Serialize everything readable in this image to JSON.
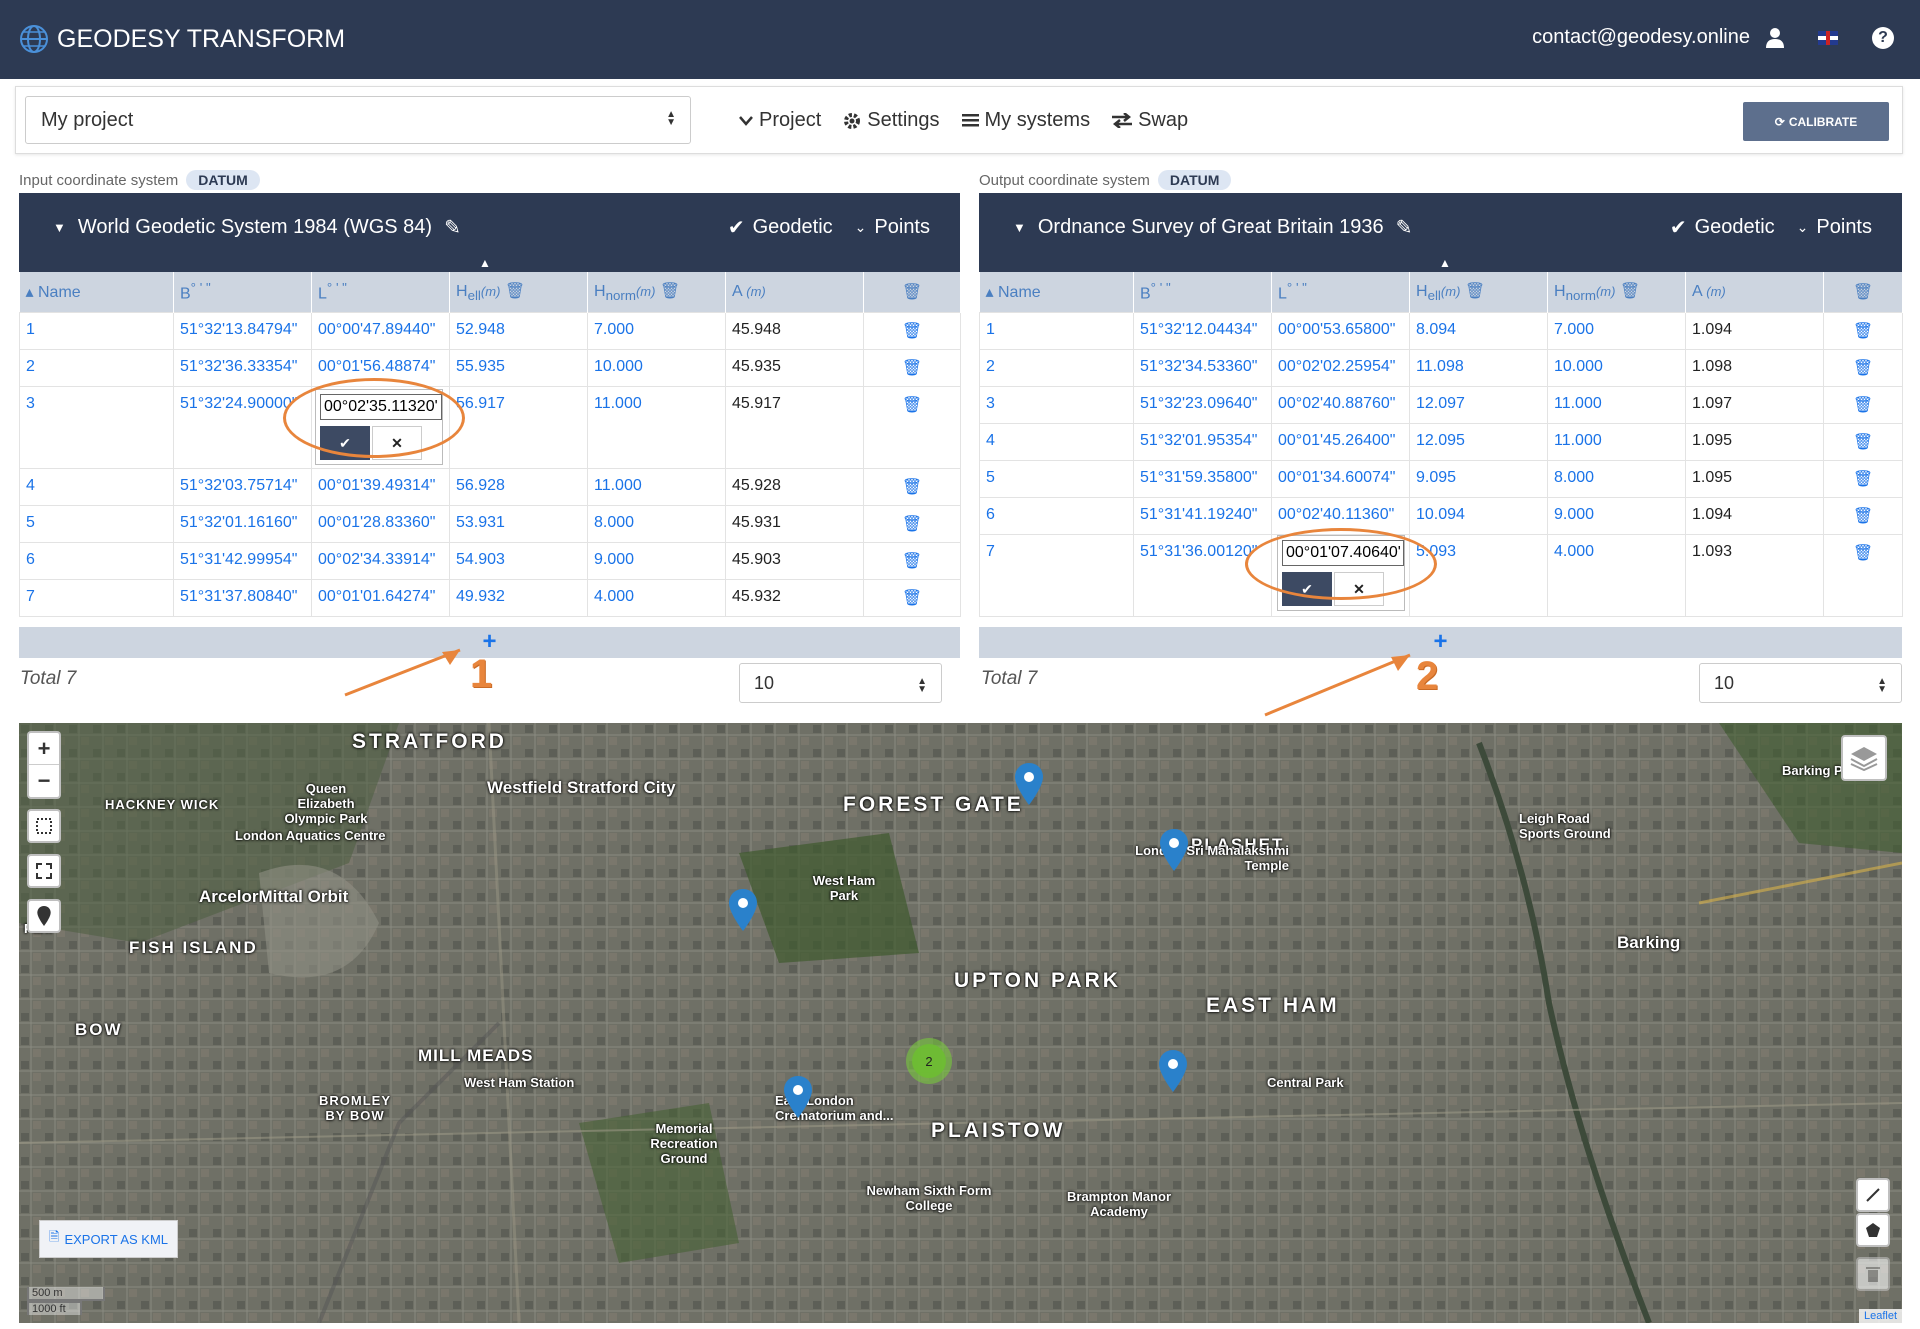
{
  "app": {
    "title": "GEODESY TRANSFORM",
    "email": "contact@geodesy.online"
  },
  "toolbar": {
    "project": "My project",
    "tabs": [
      "Project",
      "Settings",
      "My systems",
      "Swap"
    ],
    "calibrate": "CALIBRATE"
  },
  "input": {
    "label": "Input coordinate system",
    "badge": "DATUM",
    "system": "World Geodetic System 1984 (WGS 84)",
    "mode": "Geodetic",
    "points": "Points",
    "columns": [
      "Name",
      "B",
      "L",
      "H",
      "H",
      "A"
    ],
    "col_sub": {
      "h_ell": "ell",
      "h_norm": "norm",
      "unit": "(m)"
    },
    "rows": [
      [
        "1",
        "51°32'13.84794\"",
        "00°00'47.89440\"",
        "52.948",
        "7.000",
        "45.948"
      ],
      [
        "2",
        "51°32'36.33354\"",
        "00°01'56.48874\"",
        "55.935",
        "10.000",
        "45.935"
      ],
      [
        "3",
        "51°32'24.90000\"",
        "",
        "56.917",
        "11.000",
        "45.917"
      ],
      [
        "4",
        "51°32'03.75714\"",
        "00°01'39.49314\"",
        "56.928",
        "11.000",
        "45.928"
      ],
      [
        "5",
        "51°32'01.16160\"",
        "00°01'28.83360\"",
        "53.931",
        "8.000",
        "45.931"
      ],
      [
        "6",
        "51°31'42.99954\"",
        "00°02'34.33914\"",
        "54.903",
        "9.000",
        "45.903"
      ],
      [
        "7",
        "51°31'37.80840\"",
        "00°01'01.64274\"",
        "49.932",
        "4.000",
        "45.932"
      ]
    ],
    "edit_value": "00°02'35.11320'",
    "total": "Total 7",
    "page_size": "10",
    "annotation": "1"
  },
  "output": {
    "label": "Output coordinate system",
    "badge": "DATUM",
    "system": "Ordnance Survey of Great Britain 1936",
    "mode": "Geodetic",
    "points": "Points",
    "rows": [
      [
        "1",
        "51°32'12.04434\"",
        "00°00'53.65800\"",
        "8.094",
        "7.000",
        "1.094"
      ],
      [
        "2",
        "51°32'34.53360\"",
        "00°02'02.25954\"",
        "11.098",
        "10.000",
        "1.098"
      ],
      [
        "3",
        "51°32'23.09640\"",
        "00°02'40.88760\"",
        "12.097",
        "11.000",
        "1.097"
      ],
      [
        "4",
        "51°32'01.95354\"",
        "00°01'45.26400\"",
        "12.095",
        "11.000",
        "1.095"
      ],
      [
        "5",
        "51°31'59.35800\"",
        "00°01'34.60074\"",
        "9.095",
        "8.000",
        "1.095"
      ],
      [
        "6",
        "51°31'41.19240\"",
        "00°02'40.11360\"",
        "10.094",
        "9.000",
        "1.094"
      ],
      [
        "7",
        "51°31'36.00120\"",
        "",
        "5.093",
        "4.000",
        "1.093"
      ]
    ],
    "edit_value": "00°01'07.40640'",
    "total": "Total 7",
    "page_size": "10",
    "annotation": "2"
  },
  "map": {
    "labels_big": [
      "STRATFORD",
      "FOREST GATE",
      "PLASHET",
      "UPTON PARK",
      "EAST HAM",
      "PLAISTOW",
      "FISH ISLAND",
      "HACKNEY WICK",
      "BOW",
      "MILL MEADS",
      "BROMLEY BY BOW"
    ],
    "labels_mid": [
      "Westfield Stratford City",
      "Queen Elizabeth Olympic Park",
      "London Aquatics Centre",
      "ArcelorMittal Orbit",
      "West Ham Park",
      "London Sri Mahalakshmi Temple",
      "Leigh Road Sports Ground",
      "Barking Park",
      "Barking",
      "West Ham Station",
      "East London Crematorium and...",
      "Memorial Recreation Ground",
      "Central Park",
      "Newham Sixth Form College",
      "Brampton Manor Academy",
      "Park"
    ],
    "cluster_count": "2",
    "export": "EXPORT AS KML",
    "scale_m": "500 m",
    "scale_ft": "1000 ft",
    "attribution": "Leaflet",
    "zoom_in": "+",
    "zoom_out": "−"
  }
}
